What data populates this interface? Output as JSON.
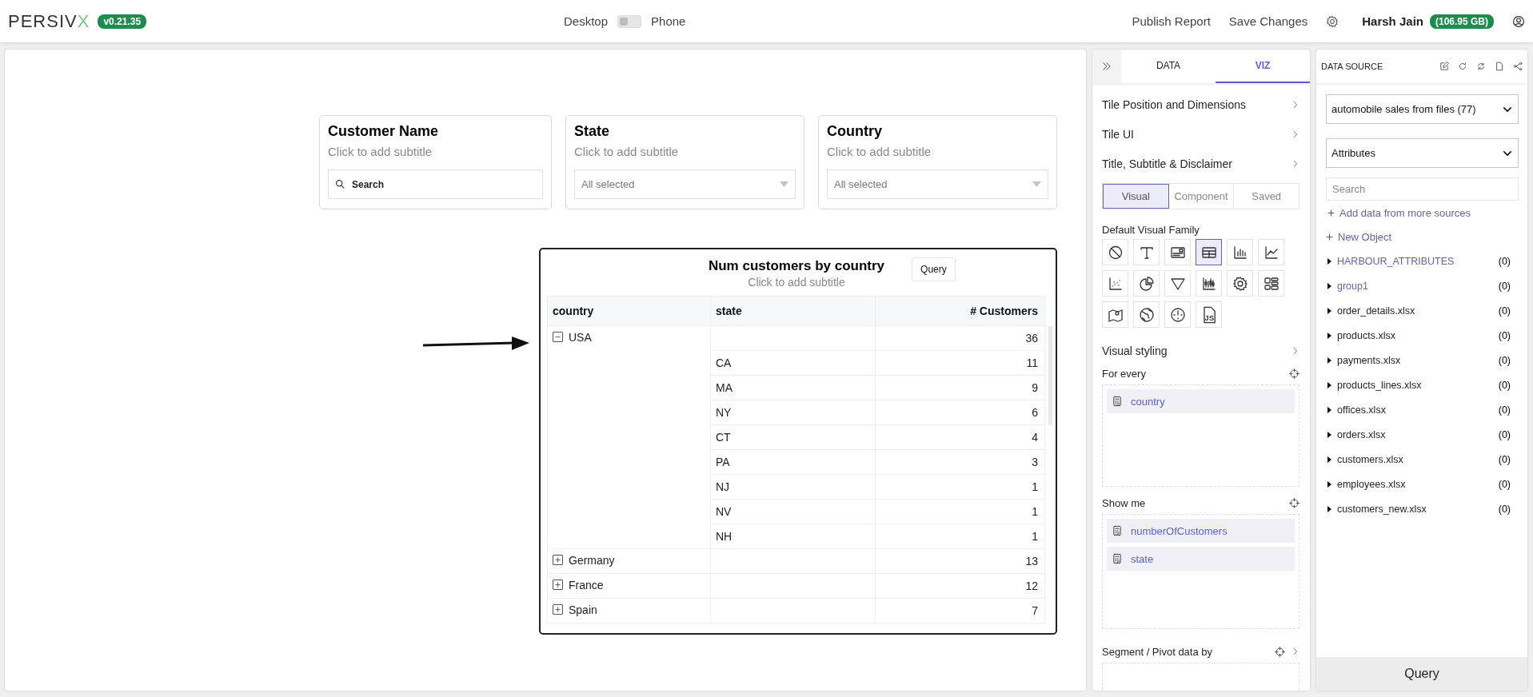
{
  "header": {
    "logo": "PERSIVX",
    "version": "v0.21.35",
    "view_toggle": {
      "left_label": "Desktop",
      "right_label": "Phone",
      "on": false
    },
    "actions": [
      "Publish Report",
      "Save Changes"
    ],
    "user_name": "Harsh Jain",
    "storage": "(106.95 GB)"
  },
  "filters": [
    {
      "title": "Customer Name",
      "subtitle": "Click to add subtitle",
      "kind": "search",
      "placeholder": "Search"
    },
    {
      "title": "State",
      "subtitle": "Click to add subtitle",
      "kind": "dropdown",
      "value": "All selected"
    },
    {
      "title": "Country",
      "subtitle": "Click to add subtitle",
      "kind": "dropdown",
      "value": "All selected"
    }
  ],
  "table_tile": {
    "title": "Num customers by country",
    "subtitle": "Click to add subtitle",
    "query_button": "Query",
    "columns": [
      "country",
      "state",
      "# Customers"
    ],
    "rows": [
      {
        "country": "USA",
        "expanded": true,
        "value": "36",
        "children": [
          {
            "state": "CA",
            "value": "11"
          },
          {
            "state": "MA",
            "value": "9"
          },
          {
            "state": "NY",
            "value": "6"
          },
          {
            "state": "CT",
            "value": "4"
          },
          {
            "state": "PA",
            "value": "3"
          },
          {
            "state": "NJ",
            "value": "1"
          },
          {
            "state": "NV",
            "value": "1"
          },
          {
            "state": "NH",
            "value": "1"
          }
        ]
      },
      {
        "country": "Germany",
        "expanded": false,
        "value": "13"
      },
      {
        "country": "France",
        "expanded": false,
        "value": "12"
      },
      {
        "country": "Spain",
        "expanded": false,
        "value": "7"
      }
    ]
  },
  "viz_panel": {
    "tabs": [
      {
        "label": "DATA",
        "selected": false
      },
      {
        "label": "VIZ",
        "selected": true
      }
    ],
    "sections": [
      "Tile Position and Dimensions",
      "Tile UI",
      "Title, Subtitle & Disclaimer"
    ],
    "modes": [
      {
        "label": "Visual",
        "selected": true
      },
      {
        "label": "Component",
        "selected": false
      },
      {
        "label": "Saved",
        "selected": false
      }
    ],
    "visual_family_label": "Default Visual Family",
    "visual_types": [
      {
        "kind": "none",
        "selected": false
      },
      {
        "kind": "text",
        "selected": false
      },
      {
        "kind": "card",
        "selected": false
      },
      {
        "kind": "table",
        "selected": true
      },
      {
        "kind": "bar",
        "selected": false
      },
      {
        "kind": "line",
        "selected": false
      },
      {
        "kind": "scatter",
        "selected": false
      },
      {
        "kind": "pie",
        "selected": false
      },
      {
        "kind": "funnel",
        "selected": false
      },
      {
        "kind": "candlestick",
        "selected": false
      },
      {
        "kind": "gear",
        "selected": false
      },
      {
        "kind": "layout",
        "selected": false
      },
      {
        "kind": "map",
        "selected": false
      },
      {
        "kind": "globe",
        "selected": false
      },
      {
        "kind": "gauge",
        "selected": false
      },
      {
        "kind": "js",
        "selected": false,
        "label": "JS"
      }
    ],
    "styling": "Visual styling",
    "for_every": {
      "label": "For every",
      "fields": [
        "country"
      ]
    },
    "show_me": {
      "label": "Show me",
      "fields": [
        "numberOfCustomers",
        "state"
      ]
    },
    "segment": {
      "label": "Segment / Pivot data by"
    }
  },
  "data_source": {
    "title": "DATA SOURCE",
    "source": "automobile sales from files (77)",
    "category": "Attributes",
    "search_placeholder": "Search",
    "links": [
      "Add data from more sources",
      "New Object"
    ],
    "items": [
      {
        "name": "HARBOUR_ATTRIBUTES",
        "count": "(0)",
        "color": "#6264a7"
      },
      {
        "name": "group1",
        "count": "(0)",
        "color": "#6264a7"
      },
      {
        "name": "order_details.xlsx",
        "count": "(0)",
        "color": "#242424"
      },
      {
        "name": "products.xlsx",
        "count": "(0)",
        "color": "#242424"
      },
      {
        "name": "payments.xlsx",
        "count": "(0)",
        "color": "#242424"
      },
      {
        "name": "products_lines.xlsx",
        "count": "(0)",
        "color": "#242424"
      },
      {
        "name": "offices.xlsx",
        "count": "(0)",
        "color": "#242424"
      },
      {
        "name": "orders.xlsx",
        "count": "(0)",
        "color": "#242424"
      },
      {
        "name": "customers.xlsx",
        "count": "(0)",
        "color": "#242424"
      },
      {
        "name": "employees.xlsx",
        "count": "(0)",
        "color": "#242424"
      },
      {
        "name": "customers_new.xlsx",
        "count": "(0)",
        "color": "#242424"
      }
    ],
    "query_button": "Query"
  }
}
